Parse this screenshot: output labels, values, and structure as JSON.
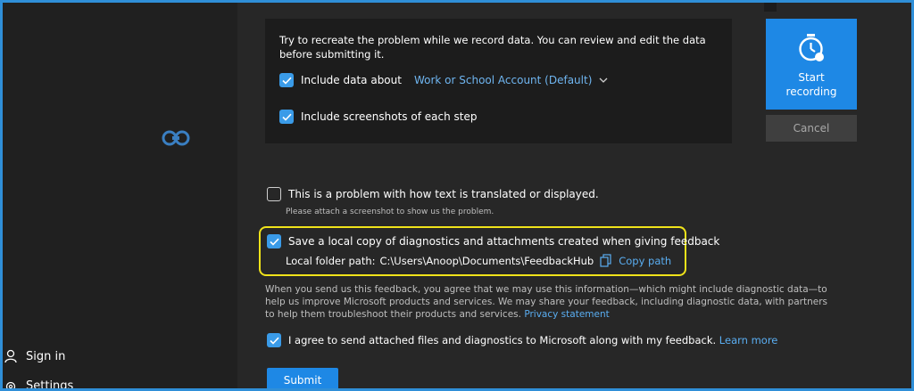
{
  "sidebar": {
    "sign_in_label": "Sign in",
    "settings_label": "Settings"
  },
  "recording": {
    "intro_text": "Try to recreate the problem while we record data. You can review and edit the data before submitting it.",
    "include_data_label": "Include data about",
    "include_data_checked": true,
    "account_selected": "Work or School Account (Default)",
    "include_screenshots_label": "Include screenshots of each step",
    "include_screenshots_checked": true,
    "start_label_line1": "Start",
    "start_label_line2": "recording",
    "cancel_label": "Cancel"
  },
  "options": {
    "translation_label": "This is a problem with how text is translated or displayed.",
    "translation_checked": false,
    "translation_hint": "Please attach a screenshot to show us the problem.",
    "save_copy_label": "Save a local copy of diagnostics and attachments created when giving feedback",
    "save_copy_checked": true,
    "folder_prefix": "Local folder path:",
    "folder_path": "C:\\Users\\Anoop\\Documents\\FeedbackHub",
    "copy_path_label": "Copy path"
  },
  "consent": {
    "text": "When you send us this feedback, you agree that we may use this information—which might include diagnostic data—to help us improve Microsoft products and services. We may share your feedback, including diagnostic data, with partners to help them troubleshoot their products and services.",
    "privacy_link": "Privacy statement",
    "agree_label": "I agree to send attached files and diagnostics to Microsoft along with my feedback.",
    "agree_checked": true,
    "learn_more": "Learn more"
  },
  "submit_label": "Submit",
  "colors": {
    "accent": "#1e88e5",
    "highlight": "#f0e31a",
    "link": "#5aaef2"
  }
}
